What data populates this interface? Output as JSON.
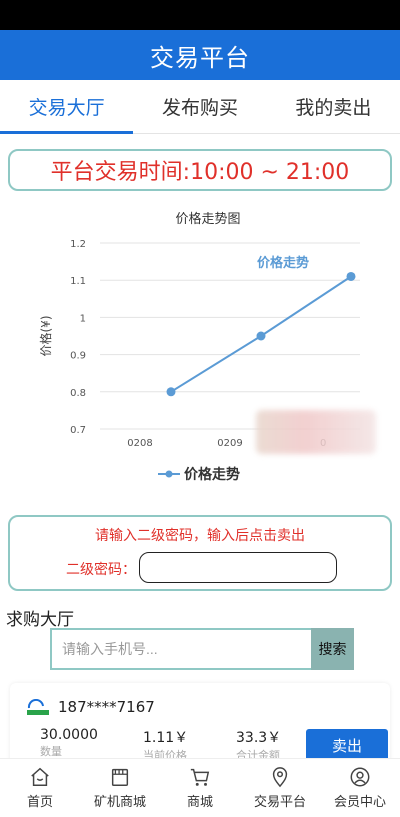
{
  "header": {
    "title": "交易平台"
  },
  "tabs": [
    {
      "label": "交易大厅",
      "active": true
    },
    {
      "label": "发布购买",
      "active": false
    },
    {
      "label": "我的卖出",
      "active": false
    }
  ],
  "banner": {
    "text": "平台交易时间:10:00 ~ 21:00"
  },
  "chart_data": {
    "type": "line",
    "title": "价格走势图",
    "ylabel": "价格(¥)",
    "xlabel": "",
    "x": [
      "0208",
      "0209",
      "0210"
    ],
    "x_tick_labels": [
      "0208",
      "0209",
      "0"
    ],
    "series": [
      {
        "name": "价格走势",
        "values": [
          0.8,
          0.95,
          1.11
        ],
        "color": "#5b9bd5"
      }
    ],
    "y_ticks": [
      "1.2",
      "1.1",
      "1",
      "0.9",
      "0.8",
      "0.7"
    ],
    "ylim": [
      0.7,
      1.2
    ],
    "grid": true,
    "legend": "bottom",
    "annotation": "价格走势"
  },
  "password": {
    "hint": "请输入二级密码，输入后点击卖出",
    "label": "二级密码："
  },
  "buy_hall": {
    "title": "求购大厅",
    "search_placeholder": "请输入手机号...",
    "search_button": "搜索"
  },
  "orders": [
    {
      "phone": "187****7167",
      "quantity": "30.0000",
      "quantity_label": "数量",
      "price": "1.11￥",
      "price_label": "当前价格",
      "total": "33.3￥",
      "total_label": "合计金额",
      "action": "卖出"
    }
  ],
  "nav": [
    {
      "label": "首页",
      "icon": "home-icon"
    },
    {
      "label": "矿机商城",
      "icon": "store-icon"
    },
    {
      "label": "商城",
      "icon": "cart-icon"
    },
    {
      "label": "交易平台",
      "icon": "location-icon"
    },
    {
      "label": "会员中心",
      "icon": "user-icon"
    }
  ],
  "colors": {
    "primary": "#1a6fd8",
    "accent_border": "#8fc8c4",
    "alert": "#e0302a",
    "series": "#5b9bd5"
  }
}
